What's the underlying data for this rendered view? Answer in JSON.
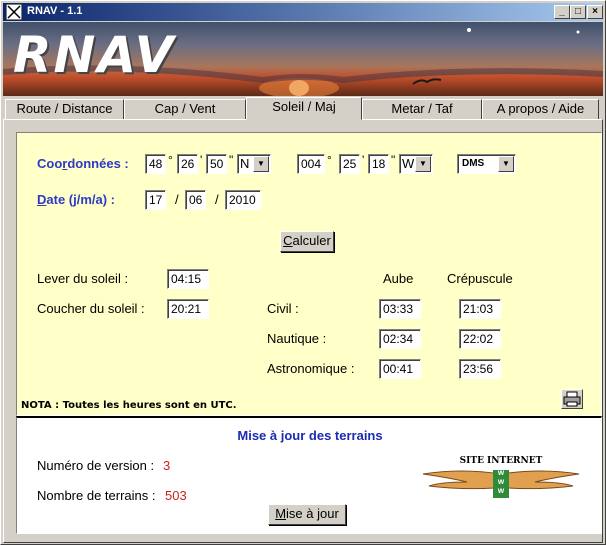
{
  "window": {
    "title": "RNAV - 1.1",
    "minimize": "_",
    "maximize": "□",
    "close": "×"
  },
  "banner": {
    "logo": "RNAV"
  },
  "tabs": [
    {
      "label": "Route / Distance"
    },
    {
      "label": "Cap / Vent"
    },
    {
      "label": "Soleil / Maj"
    },
    {
      "label": "Metar / Taf"
    },
    {
      "label": "A propos / Aide"
    }
  ],
  "coords": {
    "label_pre": "Coo",
    "label_u": "r",
    "label_post": "données :",
    "lat_deg": "48",
    "lat_min": "26",
    "lat_sec": "50",
    "lat_hemi": "N",
    "lon_deg": "004",
    "lon_min": "25",
    "lon_sec": "18",
    "lon_hemi": "W",
    "format": "DMS",
    "deg_sym": "°",
    "min_sym": "'",
    "sec_sym": "\""
  },
  "date": {
    "label_u": "D",
    "label_post": "ate (j/m/a) :",
    "day": "17",
    "month": "06",
    "year": "2010",
    "sep": "/"
  },
  "calc_button": {
    "u": "C",
    "rest": "alculer"
  },
  "sun": {
    "rise_label": "Lever du soleil :",
    "rise_value": "04:15",
    "set_label": "Coucher du soleil :",
    "set_value": "20:21",
    "dawn_header": "Aube",
    "dusk_header": "Crépuscule",
    "civil_label": "Civil :",
    "civil_dawn": "03:33",
    "civil_dusk": "21:03",
    "nautical_label": "Nautique :",
    "nautical_dawn": "02:34",
    "nautical_dusk": "22:02",
    "astro_label": "Astronomique :",
    "astro_dawn": "00:41",
    "astro_dusk": "23:56"
  },
  "nota": "NOTA : Toutes les heures sont en UTC.",
  "update": {
    "title": "Mise à jour des terrains",
    "version_label": "Numéro de version :",
    "version_value": "3",
    "count_label": "Nombre de terrains :",
    "count_value": "503",
    "button_u": "M",
    "button_rest": "ise à jour",
    "site_label": "SITE INTERNET",
    "www": [
      "w",
      "w",
      "w"
    ]
  }
}
